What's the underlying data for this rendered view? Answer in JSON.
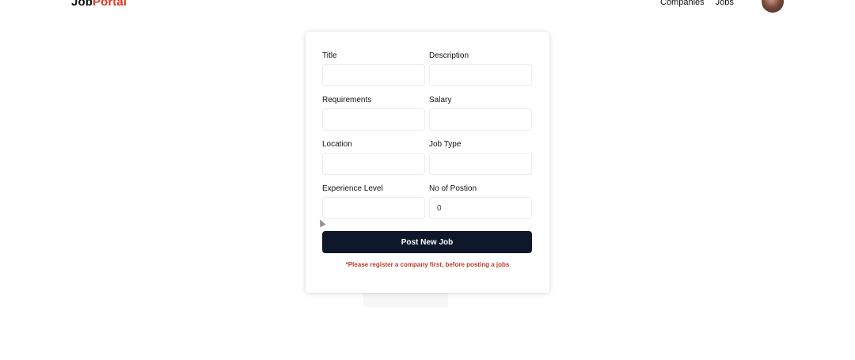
{
  "navbar": {
    "logo_part1": "Job",
    "logo_part2": "Portal",
    "links": [
      "Companies",
      "Jobs"
    ]
  },
  "form": {
    "fields": [
      {
        "label": "Title",
        "value": ""
      },
      {
        "label": "Description",
        "value": ""
      },
      {
        "label": "Requirements",
        "value": ""
      },
      {
        "label": "Salary",
        "value": ""
      },
      {
        "label": "Location",
        "value": ""
      },
      {
        "label": "Job Type",
        "value": ""
      },
      {
        "label": "Experience Level",
        "value": ""
      },
      {
        "label": "No of Postion",
        "value": "0"
      }
    ],
    "submit_label": "Post New Job",
    "warning": "*Please register a company first, before posting a jobs"
  },
  "colors": {
    "brand_accent": "#e03a1f",
    "button_bg": "#0f172a",
    "warning": "#c0392b"
  }
}
